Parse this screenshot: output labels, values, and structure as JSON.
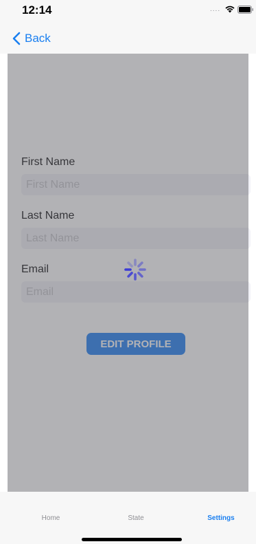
{
  "status_bar": {
    "time": "12:14",
    "signal_dots": "....",
    "icons": [
      "wifi-icon",
      "battery-icon"
    ]
  },
  "nav": {
    "back_label": "Back",
    "back_icon": "chevron-left-icon"
  },
  "form": {
    "first_name": {
      "label": "First Name",
      "placeholder": "First Name",
      "value": ""
    },
    "last_name": {
      "label": "Last Name",
      "placeholder": "Last Name",
      "value": ""
    },
    "email": {
      "label": "Email",
      "placeholder": "Email",
      "value": ""
    },
    "edit_button_label": "EDIT PROFILE"
  },
  "loading": {
    "active": true,
    "icon": "spinner-icon"
  },
  "tab_bar": {
    "tabs": [
      {
        "label": "Home",
        "selected": false
      },
      {
        "label": "State",
        "selected": false
      },
      {
        "label": "Settings",
        "selected": true
      }
    ]
  },
  "colors": {
    "accent": "#1a7ff0",
    "button": "#2b86f5",
    "spinner": "#3b3bd6",
    "overlay": "#8e8e93"
  }
}
